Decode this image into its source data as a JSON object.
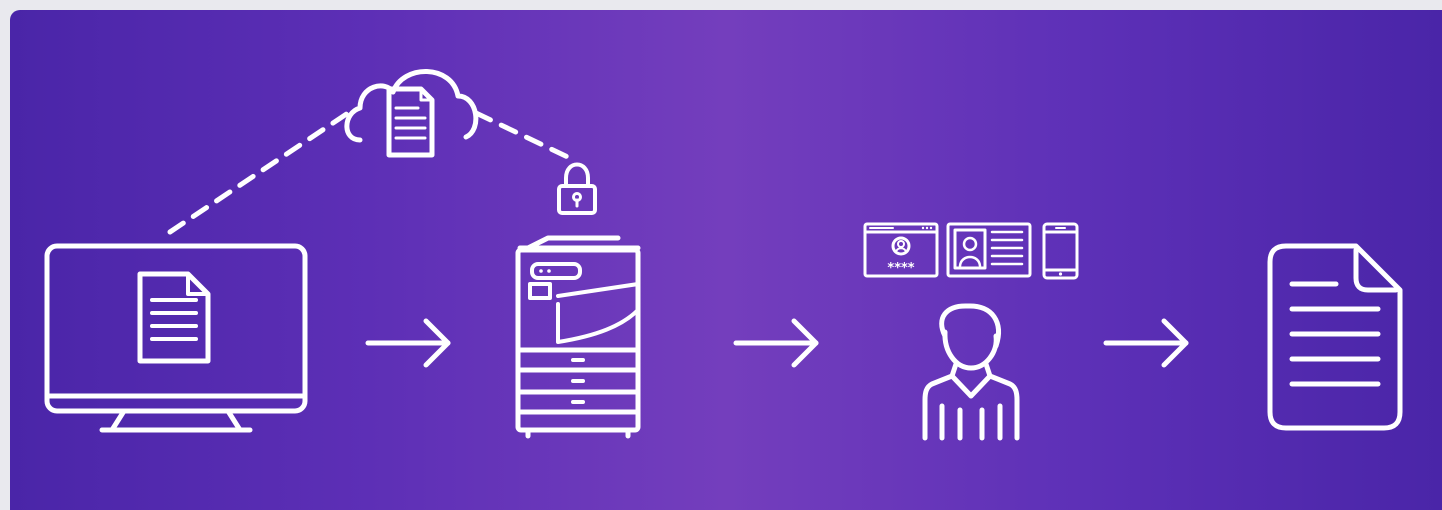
{
  "diagram": {
    "theme": {
      "gradient": [
        "#4a25a8",
        "#743ebd",
        "#4a25a8"
      ],
      "stroke": "#ffffff"
    },
    "steps": [
      {
        "icon": "monitor-with-document-icon"
      },
      {
        "icon": "printer-icon"
      },
      {
        "icon": "user-authentication-icon"
      },
      {
        "icon": "printed-document-icon"
      }
    ],
    "connectors": [
      "arrow-right-icon",
      "arrow-right-icon",
      "arrow-right-icon"
    ],
    "cloud_link": {
      "icon": "cloud-document-icon",
      "secured_by": "padlock-icon"
    },
    "auth_methods": [
      {
        "icon": "pin-login-window-icon",
        "pin_mask": "****"
      },
      {
        "icon": "id-card-icon"
      },
      {
        "icon": "mobile-phone-icon"
      }
    ]
  }
}
